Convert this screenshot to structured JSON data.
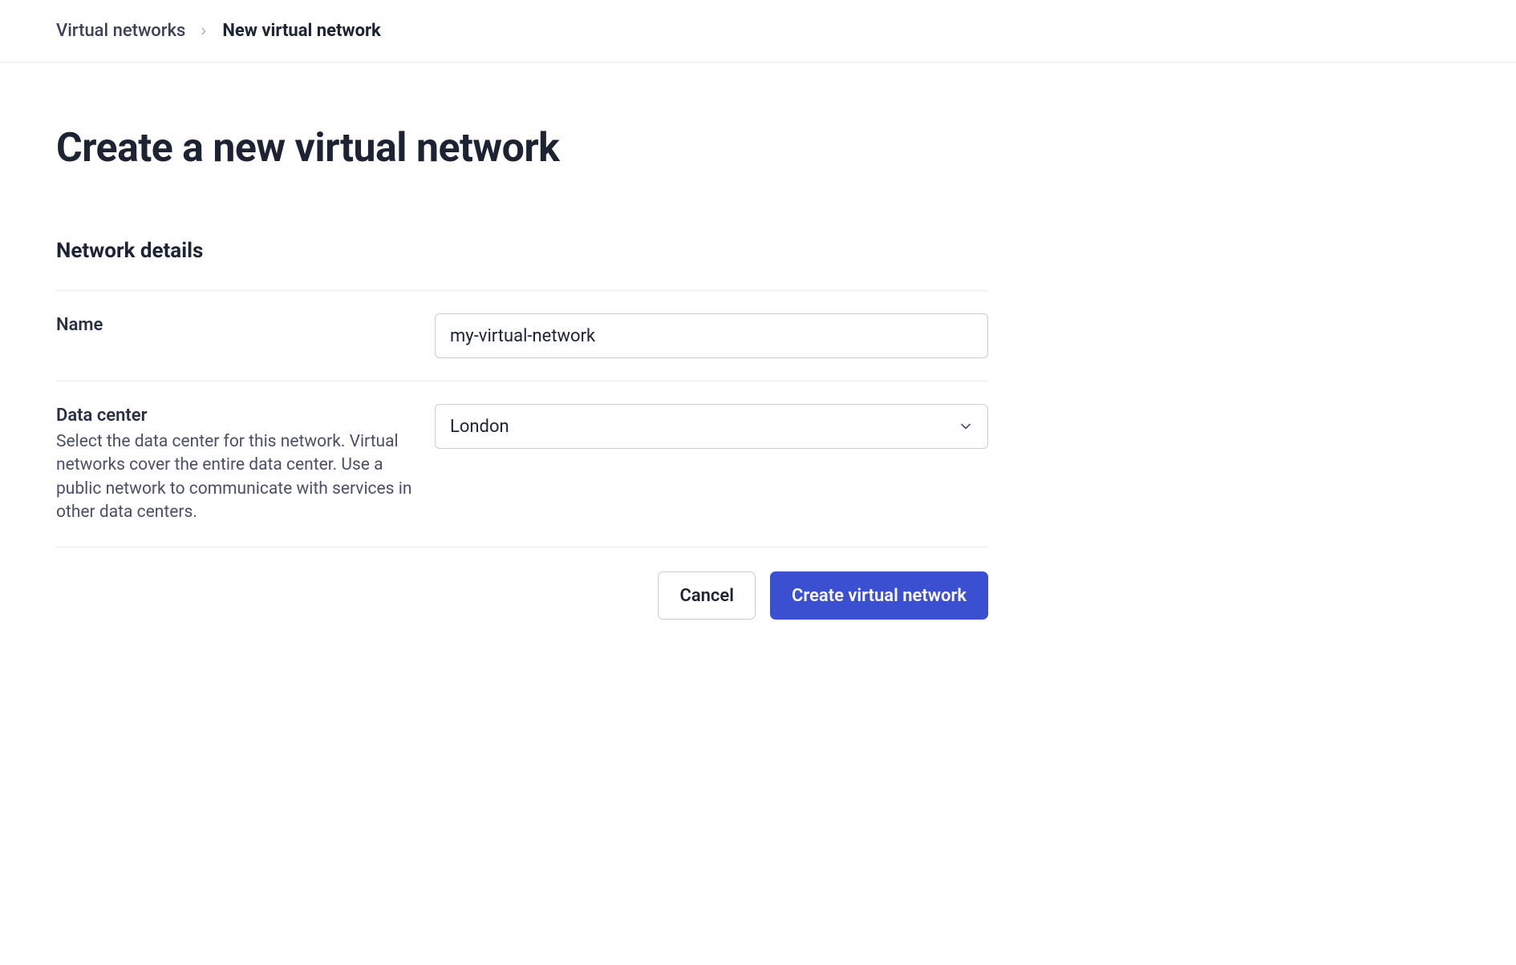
{
  "breadcrumb": {
    "parent": "Virtual networks",
    "current": "New virtual network"
  },
  "page": {
    "title": "Create a new virtual network"
  },
  "section": {
    "network_details": "Network details"
  },
  "fields": {
    "name": {
      "label": "Name",
      "value": "my-virtual-network"
    },
    "data_center": {
      "label": "Data center",
      "help": "Select the data center for this network. Virtual networks cover the entire data center. Use a public network to communicate with services in other data centers.",
      "value": "London"
    }
  },
  "actions": {
    "cancel": "Cancel",
    "submit": "Create virtual network"
  }
}
